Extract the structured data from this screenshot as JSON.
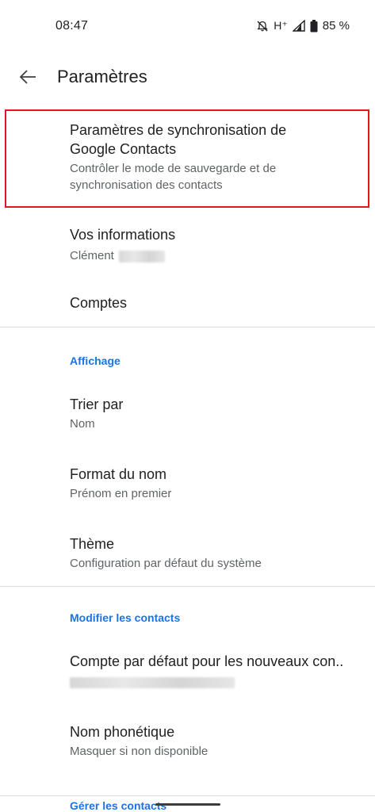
{
  "status_bar": {
    "time": "08:47",
    "network": "H⁺",
    "battery": "85 %",
    "icons": [
      "alarm-off-icon",
      "signal-icon",
      "battery-icon"
    ]
  },
  "app_bar": {
    "title": "Paramètres",
    "back_icon": "arrow-back-icon"
  },
  "items": {
    "sync": {
      "title": "Paramètres de synchronisation de Google Contacts",
      "subtitle": "Contrôler le mode de sauvegarde et de synchronisation des contacts"
    },
    "your_info": {
      "title": "Vos informations",
      "subtitle": "Clément"
    },
    "accounts": {
      "title": "Comptes"
    }
  },
  "sections": {
    "display": {
      "header": "Affichage",
      "sort_by": {
        "title": "Trier par",
        "subtitle": "Nom"
      },
      "name_format": {
        "title": "Format du nom",
        "subtitle": "Prénom en premier"
      },
      "theme": {
        "title": "Thème",
        "subtitle": "Configuration par défaut du système"
      }
    },
    "edit_contacts": {
      "header": "Modifier les contacts",
      "default_account": {
        "title": "Compte par défaut pour les nouveaux con.."
      },
      "phonetic_name": {
        "title": "Nom phonétique",
        "subtitle": "Masquer si non disponible"
      }
    },
    "manage_contacts": {
      "header": "Gérer les contacts"
    }
  },
  "colors": {
    "accent": "#1a73e8",
    "highlight": "#e4161b",
    "divider": "#dadce0"
  }
}
